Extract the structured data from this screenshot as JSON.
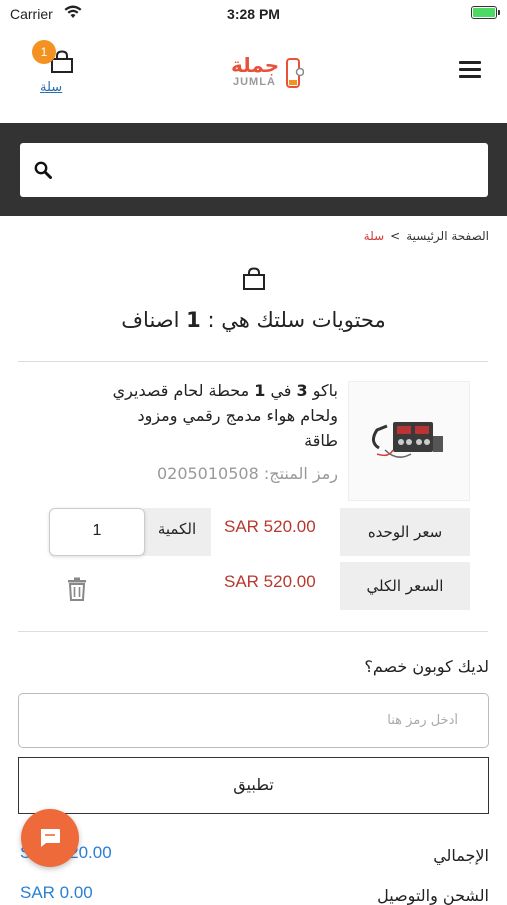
{
  "status_bar": {
    "carrier": "Carrier",
    "time": "3:28 PM"
  },
  "header": {
    "cart_badge": "1",
    "cart_label": "سلة",
    "logo_ar": "جملة",
    "logo_en": "JUMLA"
  },
  "search": {
    "placeholder": ""
  },
  "breadcrumb": {
    "home": "الصفحة الرئيسية",
    "separator": ">",
    "current": "سلة"
  },
  "cart": {
    "title_prefix": "محتويات سلتك هي :",
    "count": "1",
    "title_suffix": "اصناف"
  },
  "product": {
    "name_part1": "باكو",
    "name_num1": "3",
    "name_part2": "في",
    "name_num2": "1",
    "name_part3": "محطة لحام قصديري ولحام هواء مدمج رقمي ومزود طاقة",
    "code_label": "رمز المنتج:",
    "code_value": "0205010508",
    "unit_price_label": "سعر الوحده",
    "unit_price": "SAR 520.00",
    "quantity_label": "الكمية",
    "quantity": "1",
    "total_price_label": "السعر الكلي",
    "total_price": "SAR 520.00"
  },
  "coupon": {
    "question": "لديك كوبون خصم؟",
    "placeholder": "أدخل رمز هنا",
    "apply_label": "تطبيق"
  },
  "totals": [
    {
      "label": "الإجمالي",
      "value": "SAR 520.00"
    },
    {
      "label": "الشحن والتوصيل",
      "value": "SAR 0.00"
    }
  ],
  "colors": {
    "accent_orange": "#f39221",
    "price_red": "#b8382e",
    "link_blue": "#2a7fd4",
    "search_band": "#333333",
    "chat_button": "#ee6a3a"
  }
}
